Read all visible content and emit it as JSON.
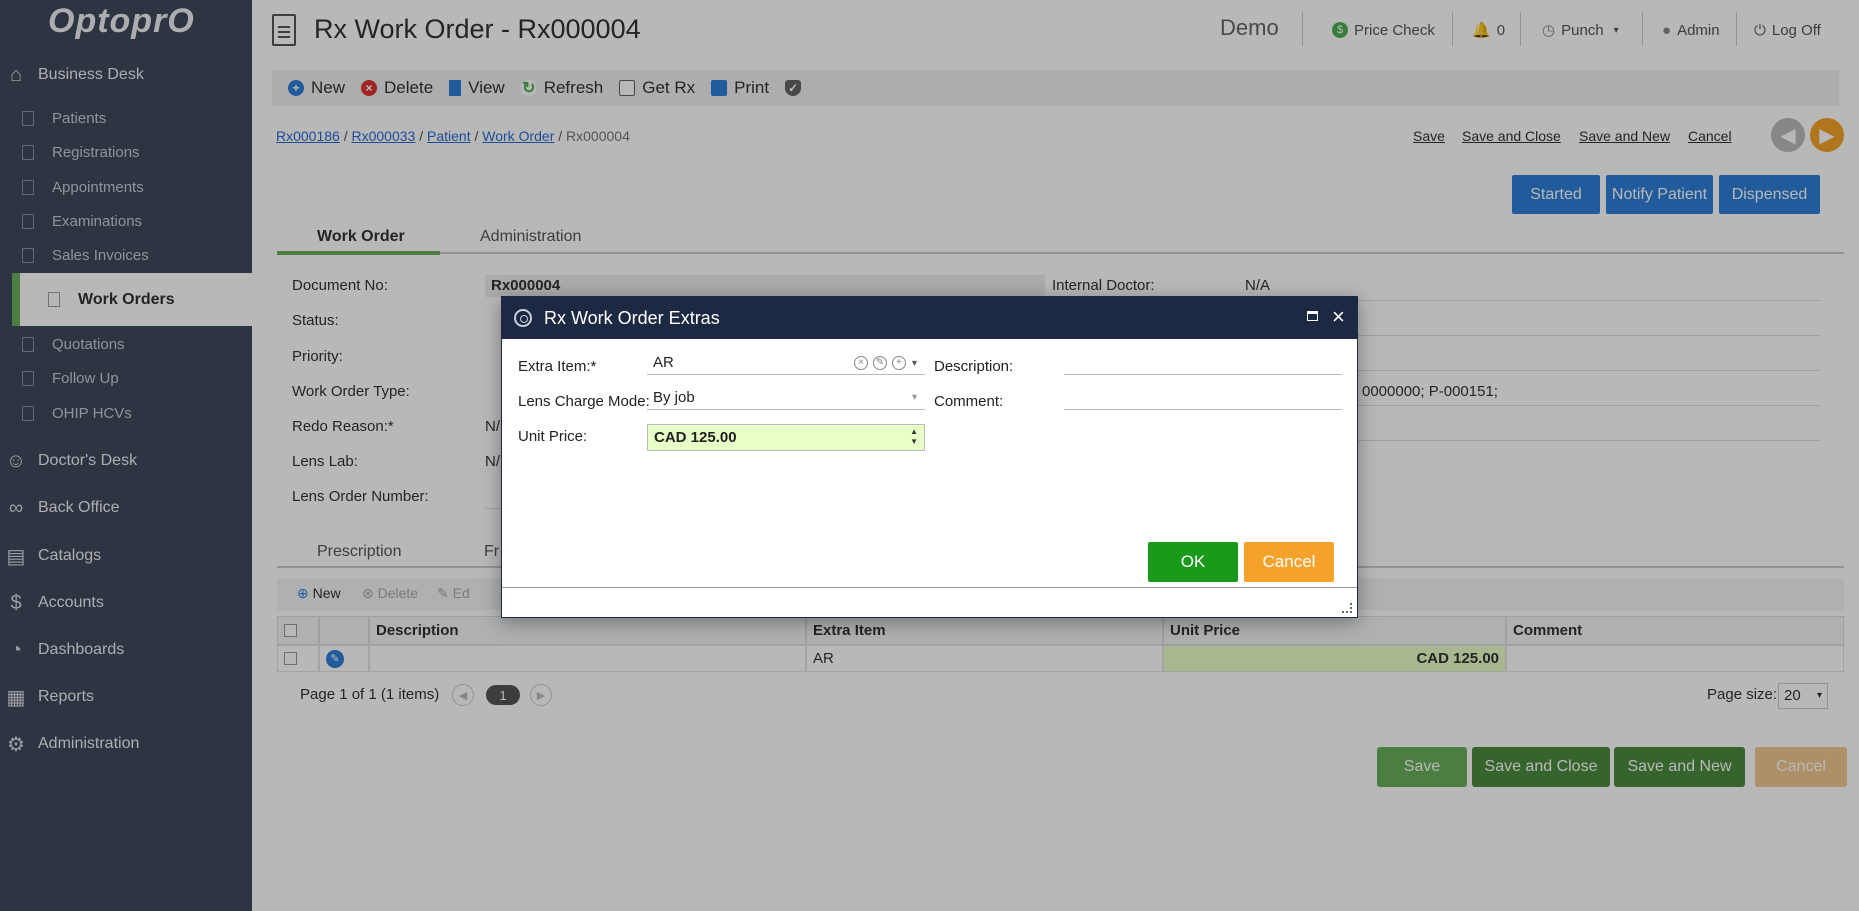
{
  "app": {
    "logo": "OptoprO",
    "demo": "Demo"
  },
  "sidebar": {
    "business_desk": "Business Desk",
    "items": [
      "Patients",
      "Registrations",
      "Appointments",
      "Examinations",
      "Sales Invoices"
    ],
    "active": "Work Orders",
    "items2": [
      "Quotations",
      "Follow Up",
      "OHIP HCVs"
    ],
    "groups": [
      "Doctor's Desk",
      "Back Office",
      "Catalogs",
      "Accounts",
      "Dashboards",
      "Reports",
      "Administration"
    ]
  },
  "header": {
    "title": "Rx Work Order - Rx000004",
    "price_check": "Price Check",
    "notifications": "0",
    "punch": "Punch",
    "user": "Admin",
    "logoff": "Log Off"
  },
  "toolbar": {
    "new": "New",
    "delete": "Delete",
    "view": "View",
    "refresh": "Refresh",
    "getrx": "Get Rx",
    "print": "Print"
  },
  "breadcrumb": {
    "c1": "Rx000186",
    "c2": "Rx000033",
    "c3": "Patient",
    "c4": "Work Order",
    "current": "Rx000004"
  },
  "top_actions": {
    "save": "Save",
    "save_close": "Save and Close",
    "save_new": "Save and New",
    "cancel": "Cancel"
  },
  "status_buttons": {
    "started": "Started",
    "notify": "Notify Patient",
    "dispensed": "Dispensed"
  },
  "tabs": {
    "work_order": "Work Order",
    "administration": "Administration"
  },
  "form": {
    "doc_no_label": "Document No:",
    "doc_no": "Rx000004",
    "status_label": "Status:",
    "priority_label": "Priority:",
    "wo_type_label": "Work Order Type:",
    "redo_label": "Redo Reason:*",
    "redo_val": "N/",
    "lens_lab_label": "Lens Lab:",
    "lens_lab_val": "N/",
    "lens_order_label": "Lens Order Number:",
    "internal_doctor_label": "Internal Doctor:",
    "internal_doctor": "N/A",
    "right_text": "0000000; P-000151;"
  },
  "subtabs": {
    "prescription": "Prescription",
    "frames": "Fr"
  },
  "grid_toolbar": {
    "new": "New",
    "delete": "Delete",
    "edit": "Ed"
  },
  "grid": {
    "headers": {
      "description": "Description",
      "extra_item": "Extra Item",
      "unit_price": "Unit Price",
      "comment": "Comment"
    },
    "row": {
      "description": "",
      "extra_item": "AR",
      "unit_price": "CAD 125.00",
      "comment": ""
    }
  },
  "pager": {
    "text": "Page 1 of 1 (1 items)",
    "page": "1",
    "size_label": "Page size:",
    "size": "20"
  },
  "bottom_actions": {
    "save": "Save",
    "save_close": "Save and Close",
    "save_new": "Save and New",
    "cancel": "Cancel"
  },
  "dialog": {
    "title": "Rx Work Order Extras",
    "extra_item_label": "Extra Item:*",
    "extra_item": "AR",
    "lens_charge_label": "Lens Charge Mode:",
    "lens_charge": "By job",
    "unit_price_label": "Unit Price:",
    "unit_price": "CAD 125.00",
    "description_label": "Description:",
    "description": "",
    "comment_label": "Comment:",
    "comment": "",
    "ok": "OK",
    "cancel": "Cancel"
  },
  "colors": {
    "sidebar": "#3f4a5c",
    "accent_green": "#6aad5a",
    "primary_blue": "#2f7fd8",
    "dialog_header": "#1d2942",
    "ok_green": "#1a9a1a",
    "cancel_orange": "#f5a22a"
  }
}
